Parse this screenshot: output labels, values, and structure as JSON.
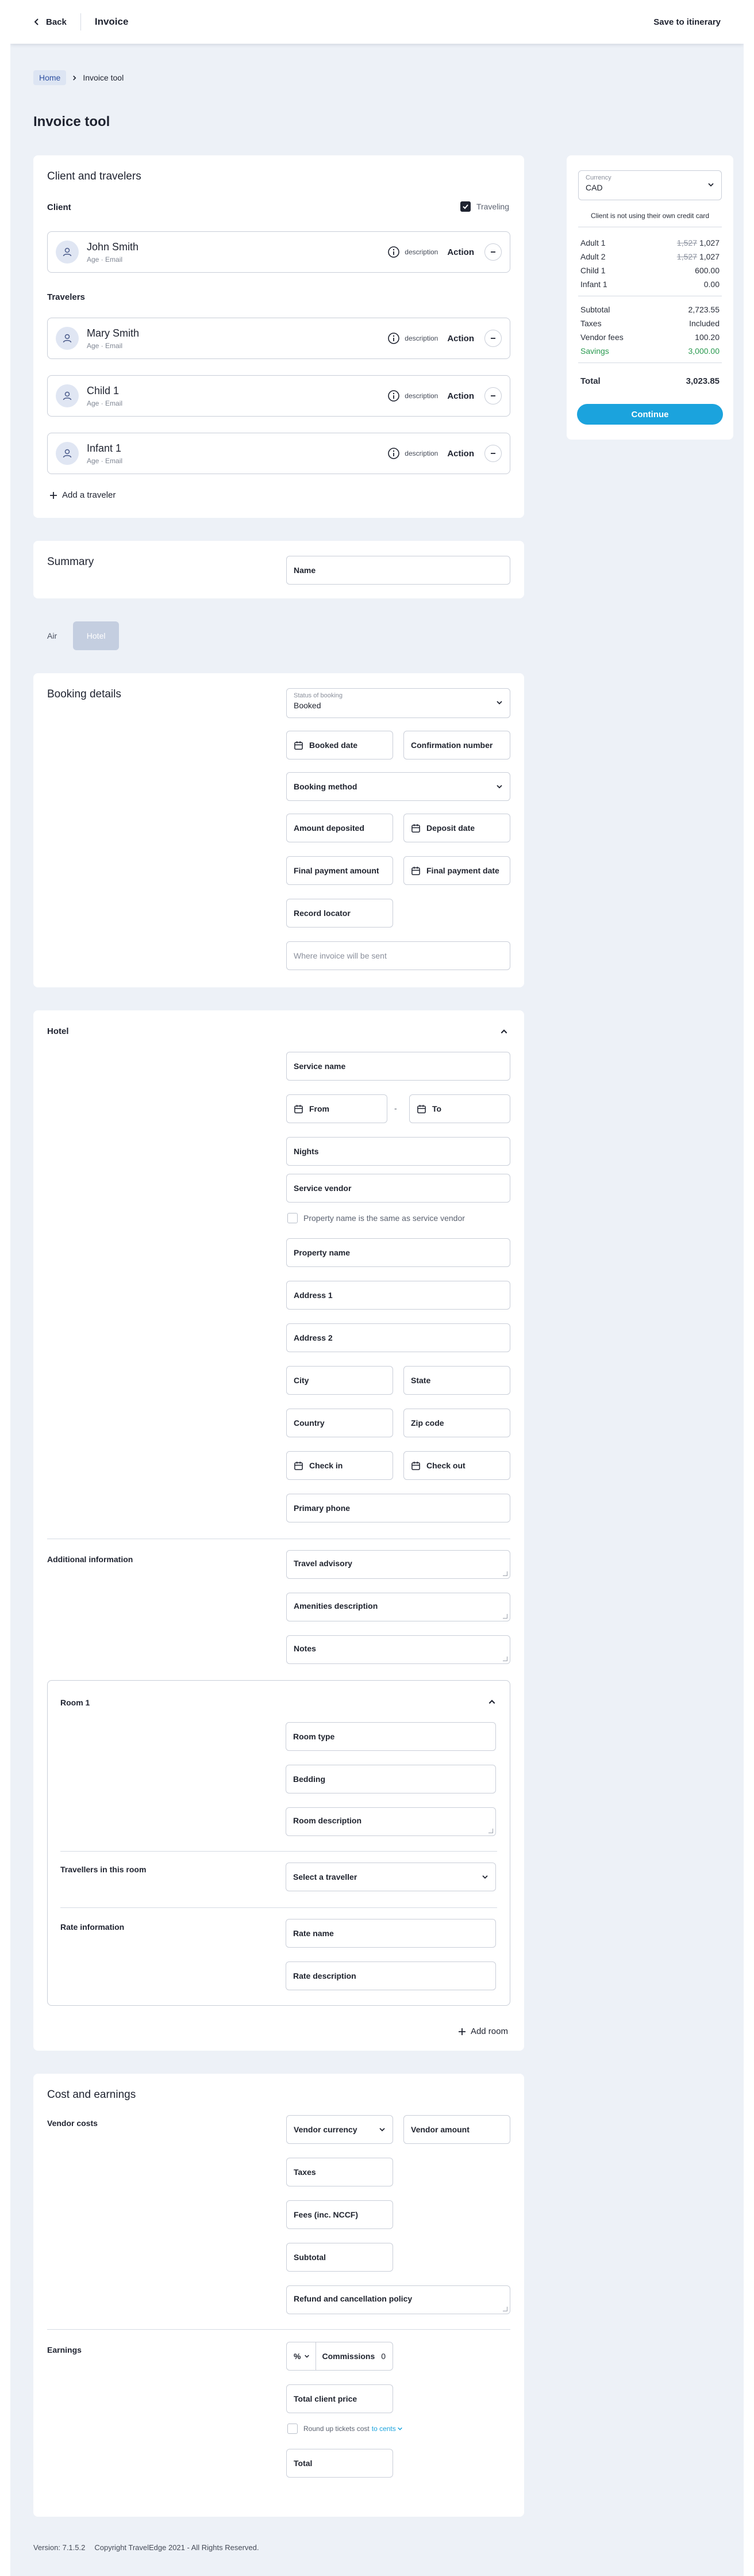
{
  "topbar": {
    "back_label": "Back",
    "title": "Invoice",
    "save_label": "Save to itinerary"
  },
  "breadcrumb": {
    "home": "Home",
    "current": "Invoice tool"
  },
  "page_title": "Invoice tool",
  "client_section": {
    "title": "Client and travelers",
    "client_heading": "Client",
    "traveling_label": "Traveling",
    "travelers_heading": "Travelers",
    "add_traveler": "Add a traveler",
    "client": {
      "name": "John Smith",
      "sub": "Age · Email",
      "description": "description",
      "action": "Action"
    },
    "travelers": [
      {
        "name": "Mary Smith",
        "sub": "Age · Email",
        "description": "description",
        "action": "Action"
      },
      {
        "name": "Child 1",
        "sub": "Age · Email",
        "description": "description",
        "action": "Action"
      },
      {
        "name": "Infant 1",
        "sub": "Age · Email",
        "description": "description",
        "action": "Action"
      }
    ]
  },
  "summary": {
    "title": "Summary",
    "name_placeholder": "Name"
  },
  "side_panel": {
    "currency_label": "Currency",
    "currency_value": "CAD",
    "note": "Client is not using their own credit card",
    "rows": [
      {
        "label": "Adult 1",
        "old": "1,527",
        "value": "1,027"
      },
      {
        "label": "Adult 2",
        "old": "1,527",
        "value": "1,027"
      },
      {
        "label": "Child 1",
        "old": "",
        "value": "600.00"
      },
      {
        "label": "Infant 1",
        "old": "",
        "value": "0.00"
      }
    ],
    "totals": [
      {
        "label": "Subtotal",
        "value": "2,723.55"
      },
      {
        "label": "Taxes",
        "value": "Included"
      },
      {
        "label": "Vendor fees",
        "value": "100.20"
      },
      {
        "label": "Savings",
        "value": "3,000.00"
      }
    ],
    "total_label": "Total",
    "total_value": "3,023.85",
    "continue_label": "Continue",
    "colors": {
      "accent": "#1ba3dd",
      "savings": "#2a9a50"
    }
  },
  "tabs": {
    "air": "Air",
    "hotel": "Hotel"
  },
  "booking": {
    "title": "Booking details",
    "status_label": "Status of booking",
    "status_value": "Booked",
    "booked_date": "Booked date",
    "confirmation_number": "Confirmation number",
    "booking_method": "Booking method",
    "amount_deposited": "Amount deposited",
    "deposit_date": "Deposit date",
    "final_payment_amount": "Final payment amount",
    "final_payment_date": "Final payment date",
    "record_locator": "Record locator",
    "invoice_destination": "Where invoice will be sent"
  },
  "hotel": {
    "title": "Hotel",
    "service_name": "Service name",
    "from": "From",
    "dash": "-",
    "to": "To",
    "nights": "Nights",
    "service_vendor": "Service vendor",
    "same_as_vendor": "Property name is the same as service vendor",
    "property_name": "Property name",
    "address1": "Address 1",
    "address2": "Address 2",
    "city": "City",
    "state": "State",
    "country": "Country",
    "zip": "Zip code",
    "check_in": "Check in",
    "check_out": "Check out",
    "primary_phone": "Primary phone",
    "additional_info": "Additional information",
    "travel_advisory": "Travel advisory",
    "amenities": "Amenities description",
    "notes": "Notes",
    "room": {
      "title": "Room 1",
      "room_type": "Room type",
      "bedding": "Bedding",
      "room_description": "Room description",
      "travellers_heading": "Travellers in this room",
      "select_traveller": "Select a traveller",
      "rate_heading": "Rate information",
      "rate_name": "Rate name",
      "rate_description": "Rate description"
    },
    "add_room": "Add room"
  },
  "cost": {
    "title": "Cost and earnings",
    "vendor_costs": "Vendor costs",
    "vendor_currency": "Vendor currency",
    "vendor_amount": "Vendor amount",
    "taxes": "Taxes",
    "fees": "Fees (inc. NCCF)",
    "subtotal": "Subtotal",
    "refund_policy": "Refund and cancellation policy",
    "earnings": "Earnings",
    "percent_symbol": "%",
    "commissions": "Commissions",
    "commissions_value": "0",
    "total_client_price": "Total client price",
    "round_up_prefix": "Round up tickets cost",
    "round_up_link": "to cents",
    "total": "Total"
  },
  "footer": {
    "version": "Version: 7.1.5.2",
    "copyright": "Copyright TravelEdge 2021 - All Rights Reserved."
  }
}
